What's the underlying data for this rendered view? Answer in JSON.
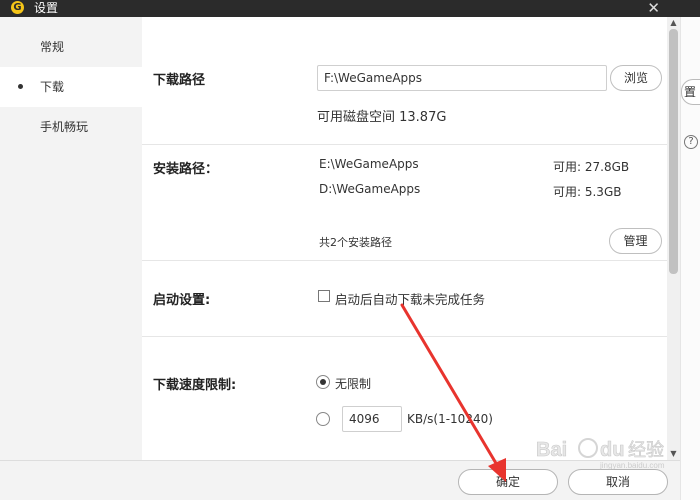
{
  "window": {
    "title": "设置",
    "logo_letter": "G",
    "close_glyph": "✕"
  },
  "sidebar": {
    "items": [
      {
        "label": "常规"
      },
      {
        "label": "下载"
      },
      {
        "label": "手机畅玩"
      }
    ],
    "active_index": 1
  },
  "download": {
    "path_label": "下载路径",
    "path_value": "F:\\WeGameApps",
    "browse_label": "浏览",
    "free_space": "可用磁盘空间 13.87G"
  },
  "install": {
    "label": "安装路径：",
    "paths": [
      {
        "path": "E:\\WeGameApps",
        "free": "可用: 27.8GB"
      },
      {
        "path": "D:\\WeGameApps",
        "free": "可用: 5.3GB"
      }
    ],
    "count_text": "共2个安装路径",
    "manage_label": "管理"
  },
  "startup": {
    "label": "启动设置:",
    "option": "启动后自动下载未完成任务",
    "checked": false
  },
  "speed": {
    "label": "下载速度限制:",
    "unlimited_label": "无限制",
    "unlimited_checked": true,
    "limit_value": "4096",
    "limit_unit": "KB/s(1-10240)"
  },
  "footer": {
    "confirm_label": "确定",
    "cancel_label": "取消"
  },
  "background": {
    "partial_button_text": "置",
    "help_glyph": "?"
  },
  "watermark": {
    "text": "Bai du 经验",
    "subtext": "jingyan.baidu.com"
  },
  "colors": {
    "annotation_arrow": "#e8342e",
    "titlebar": "#2b2b2b",
    "logo": "#f5c518"
  }
}
